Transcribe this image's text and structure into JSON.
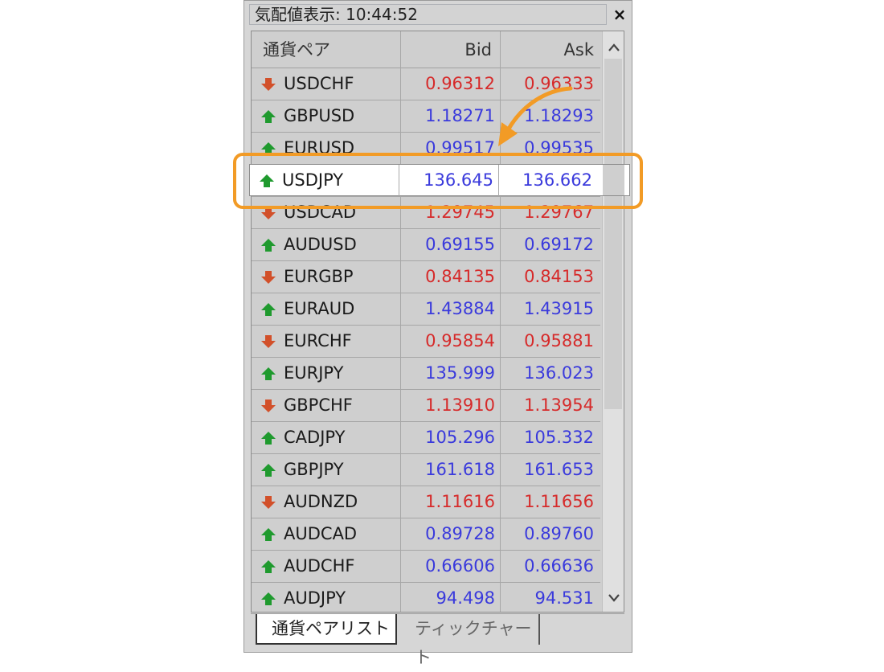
{
  "window": {
    "title": "気配値表示: 10:44:52",
    "close": "×"
  },
  "columns": {
    "symbol": "通貨ペア",
    "bid": "Bid",
    "ask": "Ask"
  },
  "rows": [
    {
      "symbol": "USDCHF",
      "bid": "0.96312",
      "ask": "0.96333",
      "dir": "down"
    },
    {
      "symbol": "GBPUSD",
      "bid": "1.18271",
      "ask": "1.18293",
      "dir": "up"
    },
    {
      "symbol": "EURUSD",
      "bid": "0.99517",
      "ask": "0.99535",
      "dir": "up"
    },
    {
      "symbol": "USDJPY",
      "bid": "136.645",
      "ask": "136.662",
      "dir": "up"
    },
    {
      "symbol": "USDCAD",
      "bid": "1.29745",
      "ask": "1.29767",
      "dir": "down"
    },
    {
      "symbol": "AUDUSD",
      "bid": "0.69155",
      "ask": "0.69172",
      "dir": "up"
    },
    {
      "symbol": "EURGBP",
      "bid": "0.84135",
      "ask": "0.84153",
      "dir": "down"
    },
    {
      "symbol": "EURAUD",
      "bid": "1.43884",
      "ask": "1.43915",
      "dir": "up"
    },
    {
      "symbol": "EURCHF",
      "bid": "0.95854",
      "ask": "0.95881",
      "dir": "down"
    },
    {
      "symbol": "EURJPY",
      "bid": "135.999",
      "ask": "136.023",
      "dir": "up"
    },
    {
      "symbol": "GBPCHF",
      "bid": "1.13910",
      "ask": "1.13954",
      "dir": "down"
    },
    {
      "symbol": "CADJPY",
      "bid": "105.296",
      "ask": "105.332",
      "dir": "up"
    },
    {
      "symbol": "GBPJPY",
      "bid": "161.618",
      "ask": "161.653",
      "dir": "up"
    },
    {
      "symbol": "AUDNZD",
      "bid": "1.11616",
      "ask": "1.11656",
      "dir": "down"
    },
    {
      "symbol": "AUDCAD",
      "bid": "0.89728",
      "ask": "0.89760",
      "dir": "up"
    },
    {
      "symbol": "AUDCHF",
      "bid": "0.66606",
      "ask": "0.66636",
      "dir": "up"
    },
    {
      "symbol": "AUDJPY",
      "bid": "94.498",
      "ask": "94.531",
      "dir": "up"
    }
  ],
  "highlighted_row": {
    "symbol": "USDJPY",
    "bid": "136.645",
    "ask": "136.662",
    "dir": "up"
  },
  "tabs": {
    "active": "通貨ペアリスト",
    "inactive": "ティックチャート"
  },
  "colors": {
    "up_price": "#3a3adc",
    "down_price": "#d62a2a",
    "up_arrow": "#1f9a2e",
    "down_arrow": "#d2502a",
    "highlight": "#f29b26"
  },
  "icons": {
    "scroll_up": "▲",
    "scroll_down": "▼"
  }
}
